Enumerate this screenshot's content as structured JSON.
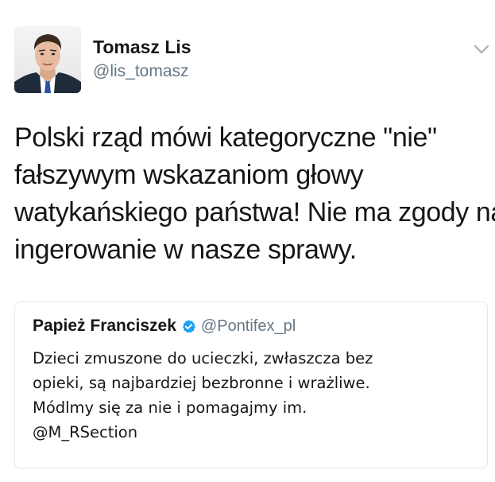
{
  "author": {
    "name": "Tomasz Lis",
    "handle": "@lis_tomasz",
    "avatar_icon": "profile-photo"
  },
  "menu": {
    "icon": "chevron-down-icon"
  },
  "tweet": {
    "lines": [
      "Polski rząd mówi kategoryczne \"nie\"",
      "fałszywym wskazaniom głowy",
      "watykańskiego państwa! Nie ma zgody na",
      "ingerowanie w nasze sprawy."
    ]
  },
  "quoted_tweet": {
    "name": "Papież Franciszek",
    "verified_icon": "verified-badge-icon",
    "handle": "@Pontifex_pl",
    "lines": [
      "Dzieci zmuszone do ucieczki, zwłaszcza bez",
      "opieki, są najbardziej bezbronne i wrażliwe.",
      "Módlmy się za nie i pomagajmy im.",
      "@M_RSection"
    ]
  },
  "colors": {
    "text": "#14171a",
    "secondary": "#657786",
    "verified": "#1da1f2",
    "border": "#e1e8ed"
  }
}
